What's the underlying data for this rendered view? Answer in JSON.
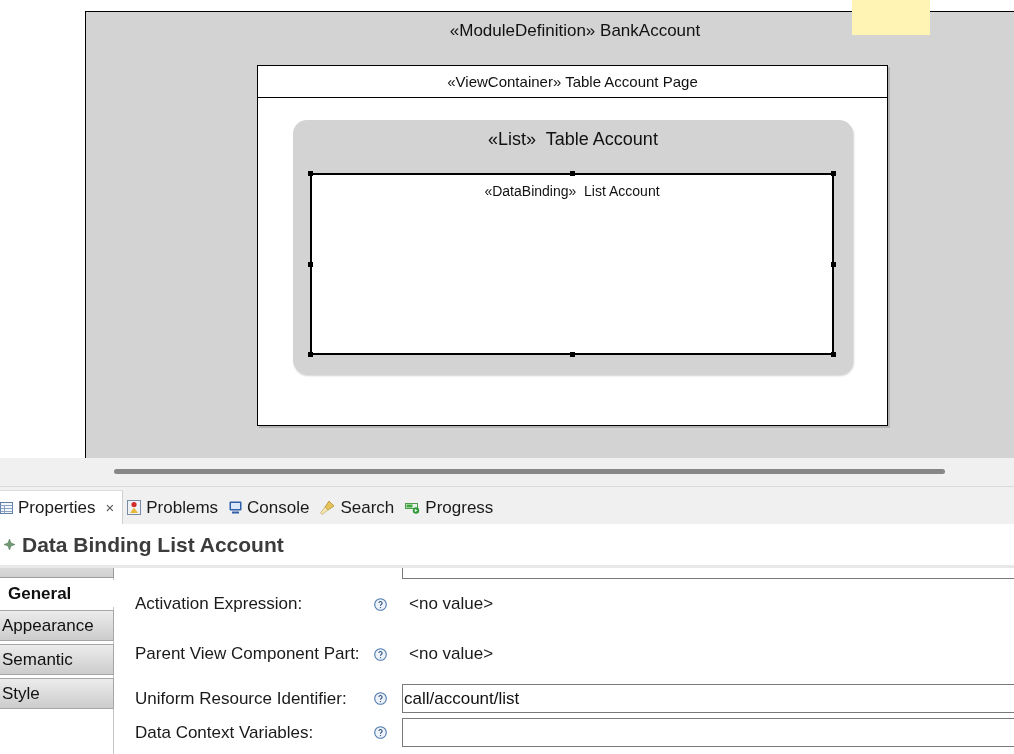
{
  "diagram": {
    "module": {
      "title": "«ModuleDefinition» BankAccount"
    },
    "view_container": {
      "title": "«ViewContainer» Table Account Page"
    },
    "list": {
      "title": "«List»  Table Account"
    },
    "data_binding": {
      "title": "«DataBinding»  List Account",
      "selected": true
    }
  },
  "view_tabs": [
    {
      "label": "Properties",
      "selected": true,
      "close": "×"
    },
    {
      "label": "Problems",
      "selected": false
    },
    {
      "label": "Console",
      "selected": false
    },
    {
      "label": "Search",
      "selected": false
    },
    {
      "label": "Progress",
      "selected": false
    }
  ],
  "properties": {
    "title": "Data Binding List Account",
    "sections": [
      {
        "label": "General",
        "selected": true
      },
      {
        "label": "Appearance",
        "selected": false
      },
      {
        "label": "Semantic",
        "selected": false
      },
      {
        "label": "Style",
        "selected": false
      }
    ],
    "fields": [
      {
        "label": "Activation Expression:",
        "kind": "text",
        "value": "<no value>"
      },
      {
        "label": "Parent View Component Part:",
        "kind": "text",
        "value": "<no value>"
      },
      {
        "label": "Uniform Resource Identifier:",
        "kind": "input",
        "value": "call/account/list"
      },
      {
        "label": "Data Context Variables:",
        "kind": "input"
      }
    ]
  }
}
